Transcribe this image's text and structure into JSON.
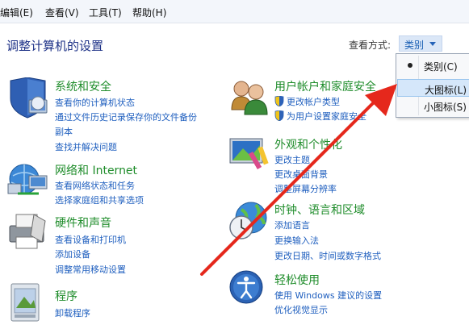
{
  "menubar": {
    "edit": "编辑(E)",
    "view": "查看(V)",
    "tools": "工具(T)",
    "help": "帮助(H)"
  },
  "header": {
    "title": "调整计算机的设置",
    "viewby_label": "查看方式:",
    "viewby_value": "类别"
  },
  "dropdown": {
    "items": [
      {
        "label": "类别(C)",
        "selected": true
      },
      {
        "label": "大图标(L)",
        "highlighted": true
      },
      {
        "label": "小图标(S)"
      }
    ]
  },
  "left": [
    {
      "title": "系统和安全",
      "icon": "shield-computer-icon",
      "links": [
        "查看你的计算机状态",
        "通过文件历史记录保存你的文件备份",
        "副本",
        "查找并解决问题"
      ]
    },
    {
      "title": "网络和 Internet",
      "icon": "network-icon",
      "links": [
        "查看网络状态和任务",
        "选择家庭组和共享选项"
      ]
    },
    {
      "title": "硬件和声音",
      "icon": "printer-icon",
      "links": [
        "查看设备和打印机",
        "添加设备",
        "调整常用移动设置"
      ]
    },
    {
      "title": "程序",
      "icon": "programs-icon",
      "links": [
        "卸载程序"
      ]
    }
  ],
  "right": [
    {
      "title": "用户帐户和家庭安全",
      "icon": "users-icon",
      "links": [
        "更改帐户类型",
        "为用户设置家庭安全"
      ]
    },
    {
      "title": "外观和个性化",
      "icon": "appearance-icon",
      "links": [
        "更改主题",
        "更改桌面背景",
        "调整屏幕分辨率"
      ]
    },
    {
      "title": "时钟、语言和区域",
      "icon": "clock-globe-icon",
      "links": [
        "添加语言",
        "更换输入法",
        "更改日期、时间或数字格式"
      ]
    },
    {
      "title": "轻松使用",
      "icon": "ease-of-access-icon",
      "links": [
        "使用 Windows 建议的设置",
        "优化视觉显示"
      ]
    }
  ],
  "colors": {
    "title_green": "#1e8c2a",
    "link_blue": "#1f5fbf",
    "arrow_red": "#e5281c",
    "highlight": "#d5e7fa"
  }
}
